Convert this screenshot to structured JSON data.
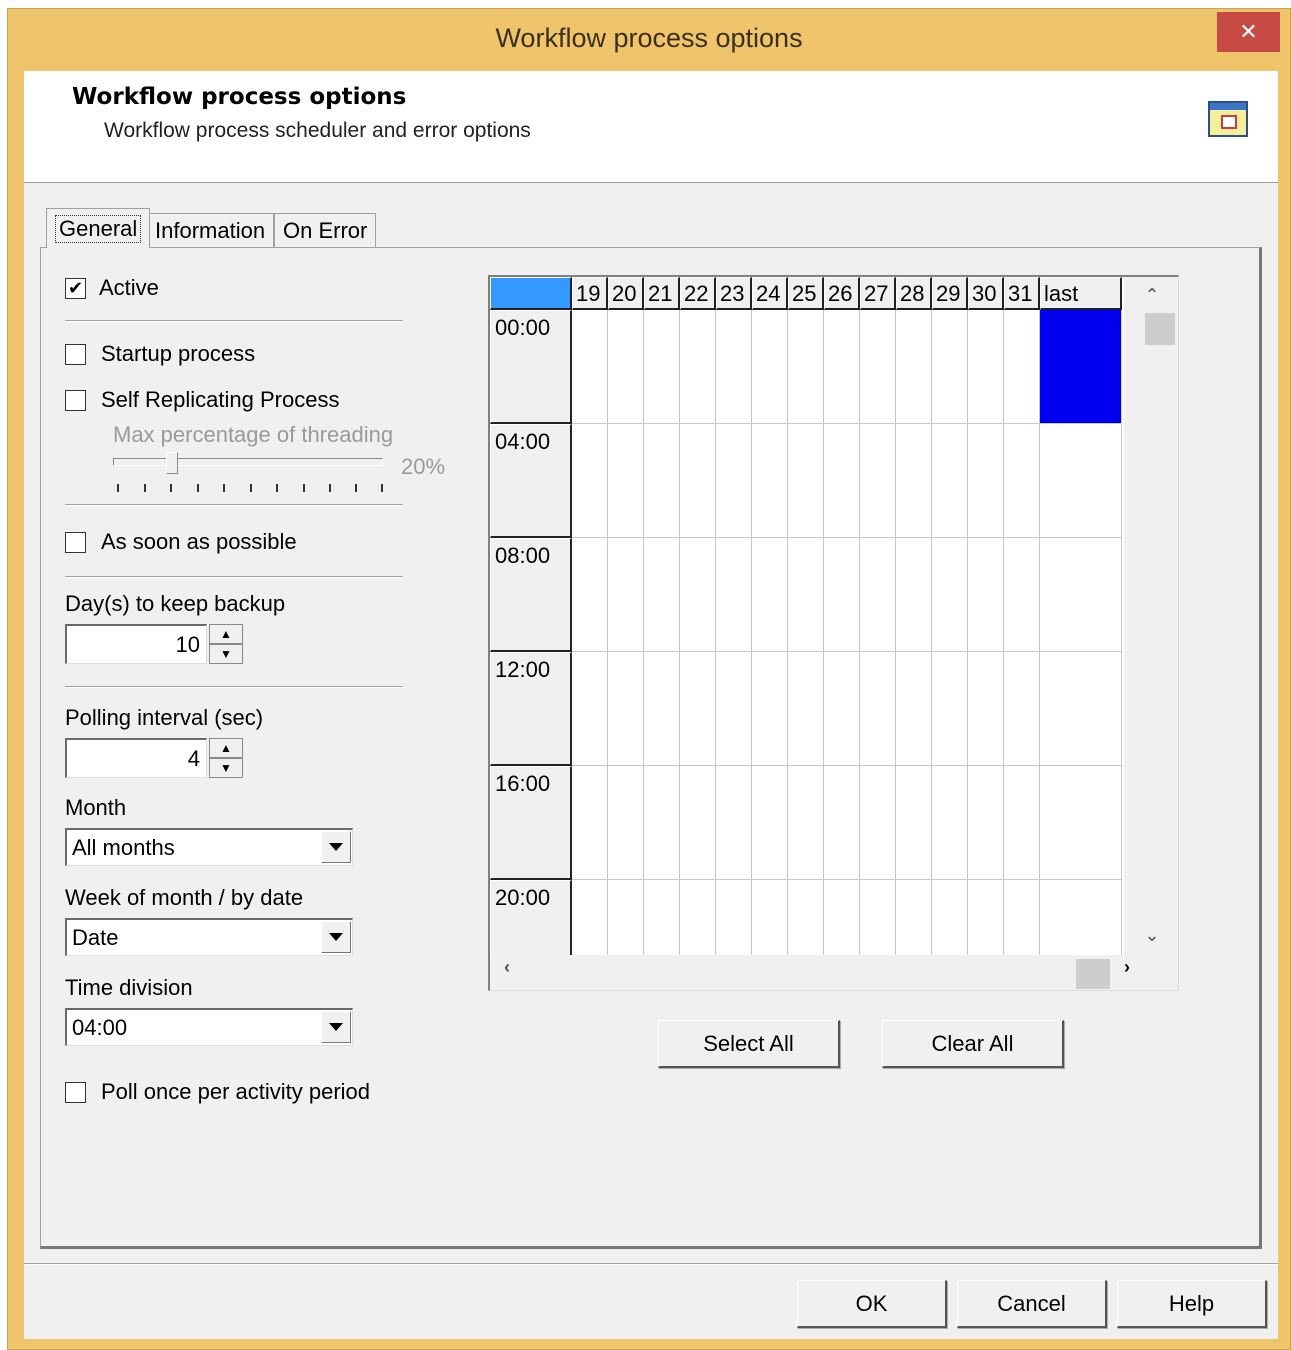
{
  "window": {
    "title": "Workflow process options",
    "close_glyph": "✕"
  },
  "header": {
    "title": "Workflow process options",
    "subtitle": "Workflow process scheduler and error options",
    "icon": "calendar-icon"
  },
  "tabs": [
    {
      "label": "General",
      "active": true
    },
    {
      "label": "Information",
      "active": false
    },
    {
      "label": "On Error",
      "active": false
    }
  ],
  "general": {
    "active": {
      "label": "Active",
      "checked": true
    },
    "startup": {
      "label": "Startup process",
      "checked": false
    },
    "self_replicating": {
      "label": "Self Replicating Process",
      "checked": false
    },
    "threading": {
      "label": "Max percentage of threading",
      "value_text": "20%",
      "value": 0.2
    },
    "asap": {
      "label": "As soon as possible",
      "checked": false
    },
    "backup": {
      "label": "Day(s) to keep backup",
      "value": "10"
    },
    "polling": {
      "label": "Polling interval (sec)",
      "value": "4"
    },
    "month": {
      "label": "Month",
      "value": "All months"
    },
    "week": {
      "label": "Week of month / by date",
      "value": "Date"
    },
    "time_division": {
      "label": "Time division",
      "value": "04:00"
    },
    "poll_once": {
      "label": "Poll once per activity period",
      "checked": false
    }
  },
  "schedule_grid": {
    "columns": [
      "19",
      "20",
      "21",
      "22",
      "23",
      "24",
      "25",
      "26",
      "27",
      "28",
      "29",
      "30",
      "31",
      "last"
    ],
    "rows": [
      "00:00",
      "04:00",
      "08:00",
      "12:00",
      "16:00",
      "20:00"
    ],
    "selected_cells": [
      {
        "row": "00:00",
        "column": "last"
      }
    ],
    "colors": {
      "selected": "#0000f0",
      "corner": "#3399ff"
    },
    "scroll": {
      "up": "⌃",
      "down": "⌄",
      "left": "‹",
      "right": "›"
    }
  },
  "grid_buttons": {
    "select_all": "Select All",
    "clear_all": "Clear All"
  },
  "footer": {
    "ok": "OK",
    "cancel": "Cancel",
    "help": "Help"
  }
}
